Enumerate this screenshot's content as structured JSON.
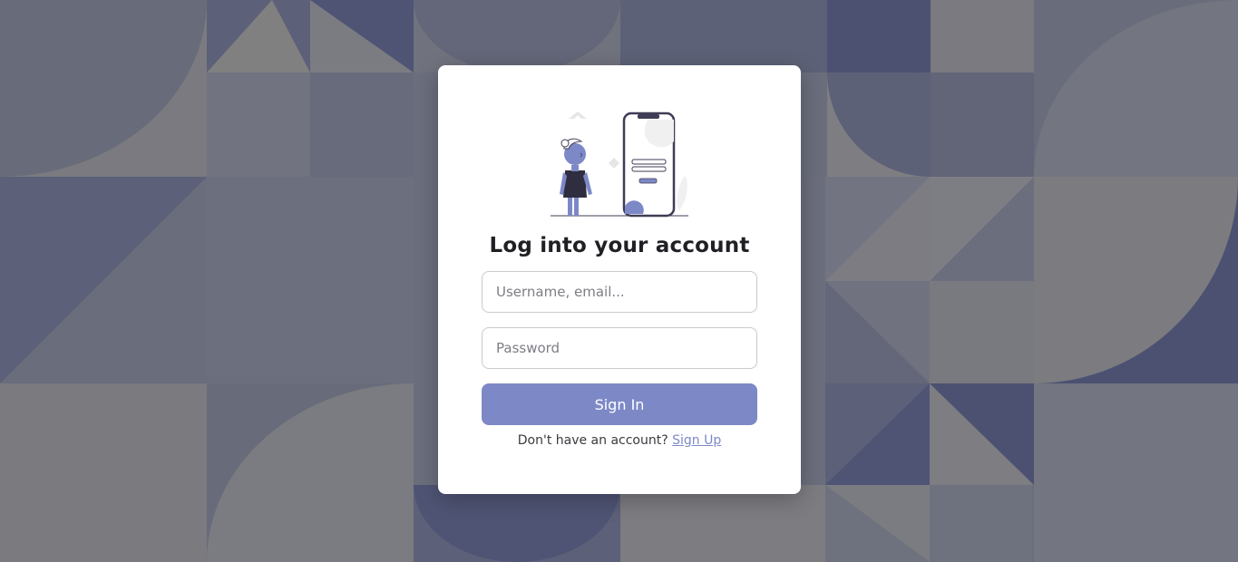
{
  "login": {
    "title": "Log into your account",
    "username_placeholder": "Username, email...",
    "password_placeholder": "Password",
    "signin_label": "Sign In",
    "signup_prompt": "Don't have an account?",
    "signup_link": "Sign Up"
  },
  "colors": {
    "accent": "#7d89c7",
    "background": "#6b6e7c",
    "card": "#ffffff",
    "title_text": "#1f1f24"
  },
  "icons": {
    "illustration": "person-with-phone-login-illustration"
  }
}
